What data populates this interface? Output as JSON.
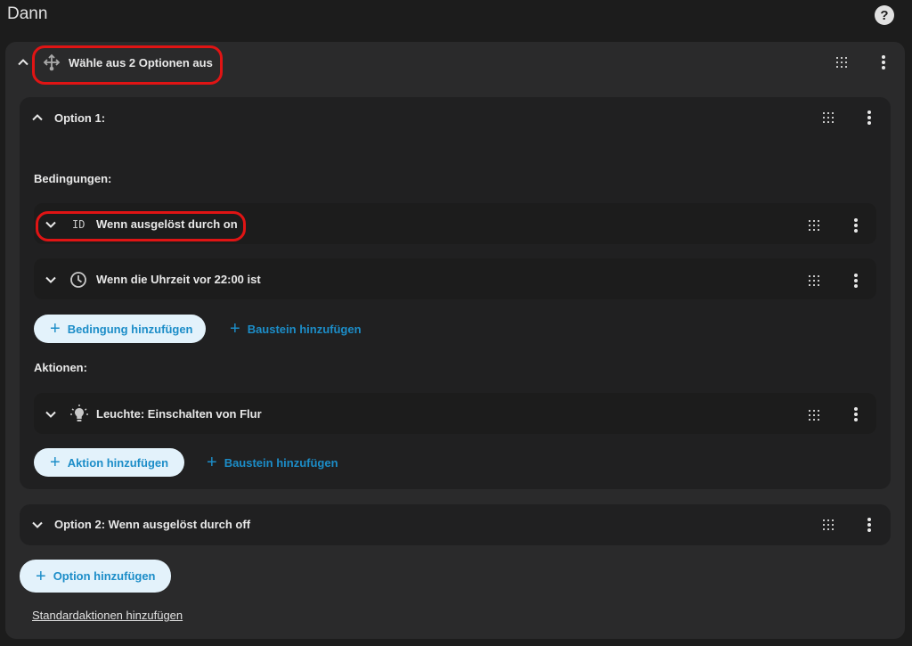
{
  "header": {
    "title": "Dann",
    "help_icon": "help-circle-icon"
  },
  "choose_block": {
    "title": "Wähle aus 2 Optionen aus",
    "icon": "shuffle-arrows-icon"
  },
  "option1": {
    "title": "Option 1:",
    "conditions_label": "Bedingungen:",
    "conditions": [
      {
        "icon_text": "ID",
        "label": "Wenn ausgelöst durch on"
      },
      {
        "icon": "clock-icon",
        "label": "Wenn die Uhrzeit vor 22:00 ist"
      }
    ],
    "add_condition": "Bedingung hinzufügen",
    "add_block_1": "Baustein hinzufügen",
    "actions_label": "Aktionen:",
    "actions": [
      {
        "icon": "lightbulb-icon",
        "label": "Leuchte: Einschalten von Flur"
      }
    ],
    "add_action": "Aktion hinzufügen",
    "add_block_2": "Baustein hinzufügen"
  },
  "option2": {
    "title": "Option 2: Wenn ausgelöst durch off"
  },
  "add_option": "Option hinzufügen",
  "default_actions_link": "Standardaktionen hinzufügen",
  "colors": {
    "accent": "#1c8dc8",
    "pill_bg": "#e3f2fb",
    "highlight": "#e01414"
  }
}
